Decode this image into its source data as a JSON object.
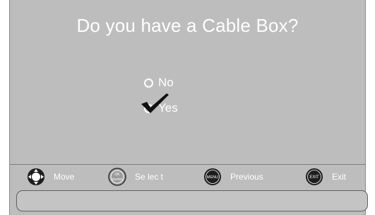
{
  "dialog": {
    "title": "Do you have a Cable Box?",
    "options": [
      {
        "label": "No",
        "selected": false
      },
      {
        "label": "Yes",
        "selected": true
      }
    ]
  },
  "legend": {
    "move": {
      "icon": "dpad-icon",
      "label": "Move"
    },
    "select": {
      "icon": "ok-enter-icon",
      "icon_text_top": "OK",
      "icon_text_bottom": "ENTER",
      "label": "Se lec t"
    },
    "previous": {
      "icon": "menu-button-icon",
      "icon_text": "MENU",
      "label": "Previous"
    },
    "exit": {
      "icon": "exit-button-icon",
      "icon_text": "EXIT",
      "label": "Exit"
    }
  },
  "colors": {
    "panel": "#bdbdbd",
    "text": "#ffffff",
    "button_dark": "#1e1e1e"
  }
}
